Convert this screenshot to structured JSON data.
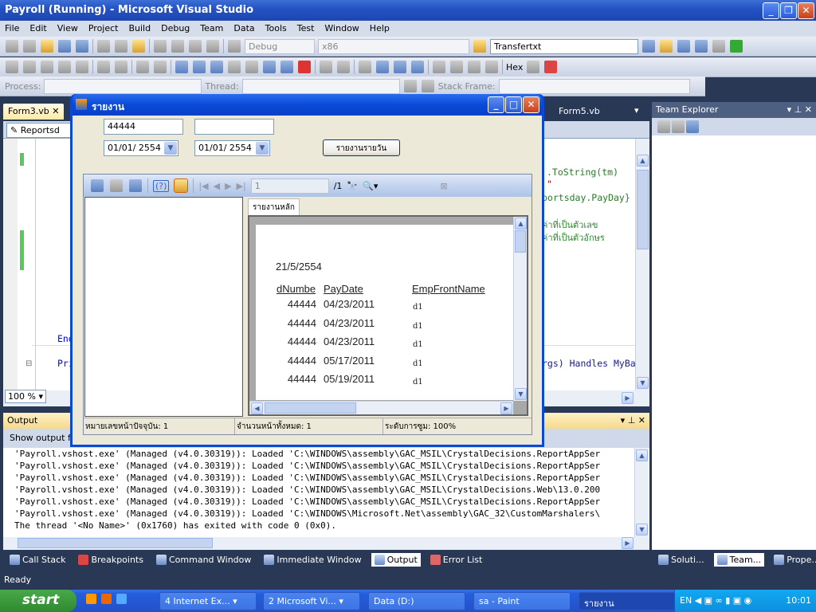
{
  "window": {
    "title": "Payroll (Running) - Microsoft Visual Studio"
  },
  "menu": [
    "File",
    "Edit",
    "View",
    "Project",
    "Build",
    "Debug",
    "Team",
    "Data",
    "Tools",
    "Test",
    "Window",
    "Help"
  ],
  "toolbar": {
    "config": "Debug",
    "platform": "x86",
    "find": "Transfertxt",
    "hex": "Hex",
    "process_label": "Process:",
    "thread_label": "Thread:",
    "stack_label": "Stack Frame:"
  },
  "doc_tabs": [
    {
      "label": "Form3.vb",
      "active": true
    },
    {
      "label": "Form5.vb",
      "active": false
    }
  ],
  "nav": {
    "object": "Reportsd"
  },
  "code": {
    "lines": [
      ".ToString(tm)",
      "\"",
      "portsday.PayDay}",
      "ค่าที่เป็นตัวเลข",
      "ค่าที่เป็นตัวอักษร",
      "End",
      "Pri",
      "rgs) Handles MyBa"
    ],
    "zoom": "100 %"
  },
  "output": {
    "title": "Output",
    "show_from": "Show output fro",
    "lines": [
      "'Payroll.vshost.exe' (Managed (v4.0.30319)): Loaded 'C:\\WINDOWS\\assembly\\GAC_MSIL\\CrystalDecisions.ReportAppSer",
      "'Payroll.vshost.exe' (Managed (v4.0.30319)): Loaded 'C:\\WINDOWS\\assembly\\GAC_MSIL\\CrystalDecisions.ReportAppSer",
      "'Payroll.vshost.exe' (Managed (v4.0.30319)): Loaded 'C:\\WINDOWS\\assembly\\GAC_MSIL\\CrystalDecisions.ReportAppSer",
      "'Payroll.vshost.exe' (Managed (v4.0.30319)): Loaded 'C:\\WINDOWS\\assembly\\GAC_MSIL\\CrystalDecisions.Web\\13.0.200",
      "'Payroll.vshost.exe' (Managed (v4.0.30319)): Loaded 'C:\\WINDOWS\\assembly\\GAC_MSIL\\CrystalDecisions.ReportAppSer",
      "'Payroll.vshost.exe' (Managed (v4.0.30319)): Loaded 'C:\\WINDOWS\\Microsoft.Net\\assembly\\GAC_32\\CustomMarshalers\\",
      "The thread '<No Name>' (0x1760) has exited with code 0 (0x0)."
    ]
  },
  "team_explorer": {
    "title": "Team Explorer"
  },
  "bottom_tabs": [
    "Call Stack",
    "Breakpoints",
    "Command Window",
    "Immediate Window",
    "Output",
    "Error List"
  ],
  "bottom_tabs_active": "Output",
  "right_tabs": [
    "Soluti...",
    "Team...",
    "Prope..."
  ],
  "status": "Ready",
  "dialog": {
    "title": "รายงาน",
    "input1": "44444",
    "input2": "",
    "date1": "01/01/ 2554",
    "date2": "01/01/ 2554",
    "button": "รายงานรายวัน",
    "viewer": {
      "page_input": "1",
      "page_total": "/1",
      "tab": "รายงานหลัก",
      "report_date": "21/5/2554",
      "columns": [
        "dNumbe",
        "PayDate",
        "EmpFrontName"
      ],
      "rows": [
        [
          "44444",
          "04/23/2011",
          "d1"
        ],
        [
          "44444",
          "04/23/2011",
          "d1"
        ],
        [
          "44444",
          "04/23/2011",
          "d1"
        ],
        [
          "44444",
          "05/17/2011",
          "d1"
        ],
        [
          "44444",
          "05/19/2011",
          "d1"
        ]
      ],
      "status": [
        "หมายเลขหน้าปัจจุบัน: 1",
        "จำนวนหน้าทั้งหมด: 1",
        "ระดับการซูม: 100%"
      ]
    }
  },
  "taskbar": {
    "start": "start",
    "tasks": [
      "4 Internet Ex...",
      "2 Microsoft Vi...",
      "Data (D:)",
      "sa - Paint",
      "รายงาน"
    ],
    "lang": "EN",
    "clock": "10:01"
  }
}
